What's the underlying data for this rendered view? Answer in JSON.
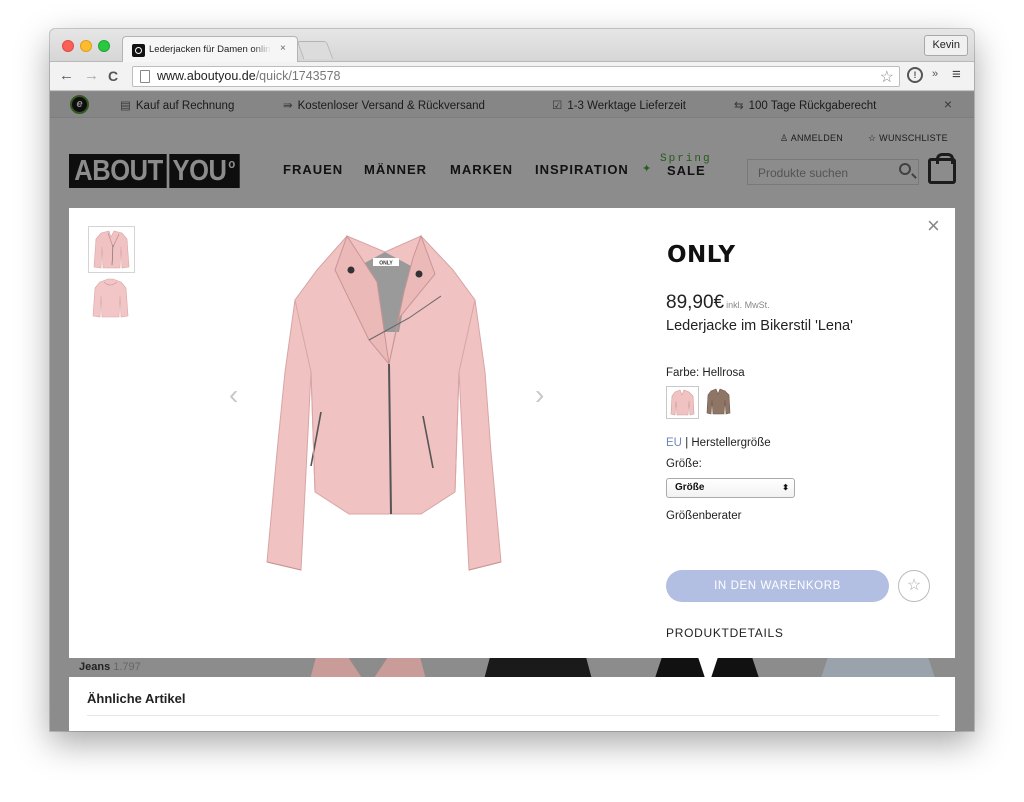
{
  "browser": {
    "tab_title": "Lederjacken für Damen online kaufen",
    "tab_close": "×",
    "profile_name": "Kevin",
    "url_host": "www.aboutyou.de",
    "url_path": "/quick/1743578",
    "nav": {
      "back": "←",
      "forward": "→",
      "reload": "C"
    },
    "star": "☆",
    "ext": "!",
    "more": "»",
    "menu": "≡"
  },
  "promo": {
    "logo_letter": "e",
    "items": [
      {
        "icon": "▤",
        "label": "Kauf auf Rechnung"
      },
      {
        "icon": "⇛",
        "label": "Kostenloser Versand & Rückversand"
      },
      {
        "icon": "☑",
        "label": "1-3 Werktage Lieferzeit"
      },
      {
        "icon": "⇆",
        "label": "100 Tage Rückgaberecht"
      }
    ],
    "close": "×"
  },
  "header": {
    "login": "ANMELDEN",
    "wishlist": "WUNSCHLISTE",
    "logo_left": "ABOUT",
    "logo_right": "YOU",
    "logo_mark": "o",
    "nav": [
      "FRAUEN",
      "MÄNNER",
      "MARKEN",
      "INSPIRATION"
    ],
    "sale_top": "Spring",
    "sale_word": "SALE",
    "search_placeholder": "Produkte suchen"
  },
  "background": {
    "category_label": "Jeans",
    "category_count": "1.797",
    "similar_title": "Ähnliche Artikel"
  },
  "modal": {
    "close": "×",
    "brand": "ONLY",
    "price": "89,90€",
    "tax_note": "inkl. MwSt.",
    "product_name": "Lederjacke im Bikerstil 'Lena'",
    "color_label": "Farbe: Hellrosa",
    "size_system_eu": "EU",
    "size_system_rest": "| Herstellergröße",
    "size_label": "Größe:",
    "size_select_value": "Größe",
    "size_guide": "Größenberater",
    "add_to_cart": "IN DEN WARENKORB",
    "product_details": "PRODUKTDETAILS",
    "prev_arrow": "‹",
    "next_arrow": "›",
    "wishlist_star": "☆",
    "jacket_label": "ONLY"
  },
  "colors": {
    "pink": "#f0c2c2",
    "taupe": "#8f7566",
    "cart_button": "#b2bfe2",
    "eu_link": "#6d86b8"
  }
}
